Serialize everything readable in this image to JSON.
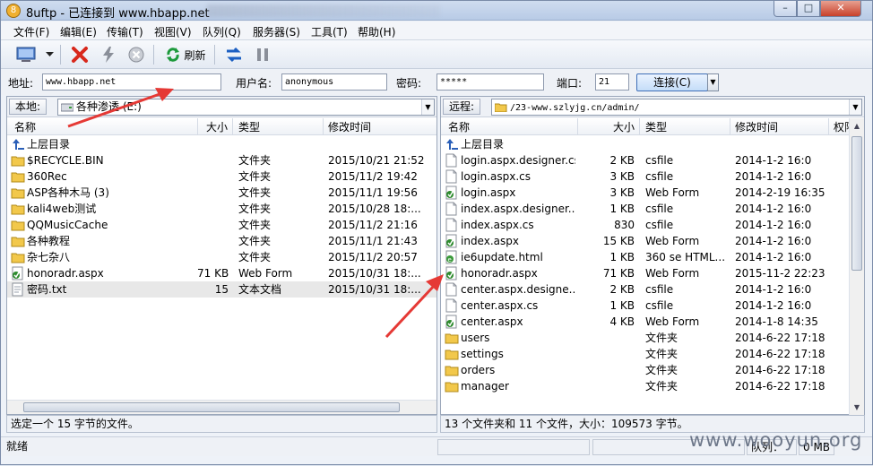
{
  "window": {
    "title": "8uftp - 已连接到 www.hbapp.net"
  },
  "menu": [
    "文件(F)",
    "编辑(E)",
    "传输(T)",
    "视图(V)",
    "队列(Q)",
    "服务器(S)",
    "工具(T)",
    "帮助(H)"
  ],
  "toolbar": {
    "refresh_label": "刷新"
  },
  "connection": {
    "address_label": "地址:",
    "address_value": "www.hbapp.net",
    "user_label": "用户名:",
    "user_value": "anonymous",
    "password_label": "密码:",
    "password_value": "*****",
    "port_label": "端口:",
    "port_value": "21",
    "connect_label": "连接(C)"
  },
  "local": {
    "label": "本地:",
    "path": "各种渗透 (E:)",
    "columns": {
      "name": "名称",
      "size": "大小",
      "type": "类型",
      "modified": "修改时间"
    },
    "rows": [
      {
        "name": "上层目录",
        "size": "",
        "type": "",
        "modified": "",
        "icon": "up-folder-icon"
      },
      {
        "name": "$RECYCLE.BIN",
        "size": "",
        "type": "文件夹",
        "modified": "2015/10/21 21:52",
        "icon": "folder-icon"
      },
      {
        "name": "360Rec",
        "size": "",
        "type": "文件夹",
        "modified": "2015/11/2 19:42",
        "icon": "folder-icon"
      },
      {
        "name": "ASP各种木马 (3)",
        "size": "",
        "type": "文件夹",
        "modified": "2015/11/1 19:56",
        "icon": "folder-icon"
      },
      {
        "name": "kali4web测试",
        "size": "",
        "type": "文件夹",
        "modified": "2015/10/28 18:...",
        "icon": "folder-icon"
      },
      {
        "name": "QQMusicCache",
        "size": "",
        "type": "文件夹",
        "modified": "2015/11/2 21:16",
        "icon": "folder-icon"
      },
      {
        "name": "各种教程",
        "size": "",
        "type": "文件夹",
        "modified": "2015/11/1 21:43",
        "icon": "folder-icon"
      },
      {
        "name": "杂七杂八",
        "size": "",
        "type": "文件夹",
        "modified": "2015/11/2 20:57",
        "icon": "folder-icon"
      },
      {
        "name": "honoradr.aspx",
        "size": "71 KB",
        "type": "Web Form",
        "modified": "2015/10/31 18:...",
        "icon": "webform-icon"
      },
      {
        "name": "密码.txt",
        "size": "15",
        "type": "文本文档",
        "modified": "2015/10/31 18:...",
        "icon": "text-file-icon"
      }
    ],
    "status": "选定一个 15 字节的文件。"
  },
  "remote": {
    "label": "远程:",
    "path": "/23-www.szlyjg.cn/admin/",
    "columns": {
      "name": "名称",
      "size": "大小",
      "type": "类型",
      "modified": "修改时间",
      "perm": "权限"
    },
    "rows": [
      {
        "name": "上层目录",
        "size": "",
        "type": "",
        "modified": "",
        "icon": "up-folder-icon"
      },
      {
        "name": "login.aspx.designer.cs",
        "size": "2 KB",
        "type": "csfile",
        "modified": "2014-1-2 16:0",
        "icon": "file-icon"
      },
      {
        "name": "login.aspx.cs",
        "size": "3 KB",
        "type": "csfile",
        "modified": "2014-1-2 16:0",
        "icon": "file-icon"
      },
      {
        "name": "login.aspx",
        "size": "3 KB",
        "type": "Web Form",
        "modified": "2014-2-19 16:35",
        "icon": "webform-icon"
      },
      {
        "name": "index.aspx.designer....",
        "size": "1 KB",
        "type": "csfile",
        "modified": "2014-1-2 16:0",
        "icon": "file-icon"
      },
      {
        "name": "index.aspx.cs",
        "size": "830",
        "type": "csfile",
        "modified": "2014-1-2 16:0",
        "icon": "file-icon"
      },
      {
        "name": "index.aspx",
        "size": "15 KB",
        "type": "Web Form",
        "modified": "2014-1-2 16:0",
        "icon": "webform-icon"
      },
      {
        "name": "ie6update.html",
        "size": "1 KB",
        "type": "360 se HTML...",
        "modified": "2014-1-2 16:0",
        "icon": "html-icon"
      },
      {
        "name": "honoradr.aspx",
        "size": "71 KB",
        "type": "Web Form",
        "modified": "2015-11-2 22:23",
        "icon": "webform-icon"
      },
      {
        "name": "center.aspx.designe...",
        "size": "2 KB",
        "type": "csfile",
        "modified": "2014-1-2 16:0",
        "icon": "file-icon"
      },
      {
        "name": "center.aspx.cs",
        "size": "1 KB",
        "type": "csfile",
        "modified": "2014-1-2 16:0",
        "icon": "file-icon"
      },
      {
        "name": "center.aspx",
        "size": "4 KB",
        "type": "Web Form",
        "modified": "2014-1-8 14:35",
        "icon": "webform-icon"
      },
      {
        "name": "users",
        "size": "",
        "type": "文件夹",
        "modified": "2014-6-22 17:18",
        "icon": "folder-icon"
      },
      {
        "name": "settings",
        "size": "",
        "type": "文件夹",
        "modified": "2014-6-22 17:18",
        "icon": "folder-icon"
      },
      {
        "name": "orders",
        "size": "",
        "type": "文件夹",
        "modified": "2014-6-22 17:18",
        "icon": "folder-icon"
      },
      {
        "name": "manager",
        "size": "",
        "type": "文件夹",
        "modified": "2014-6-22 17:18",
        "icon": "folder-icon"
      }
    ],
    "status": "13 个文件夹和 11 个文件，大小：109573 字节。"
  },
  "statusbar": {
    "left": "就绪",
    "queue": "队列：",
    "speed": "0 MB"
  },
  "watermark": "www.wooyun.org",
  "colors": {
    "annotation_arrow": "#e53935",
    "folder": "#f2c84b",
    "webform": "#2e8b2e"
  }
}
